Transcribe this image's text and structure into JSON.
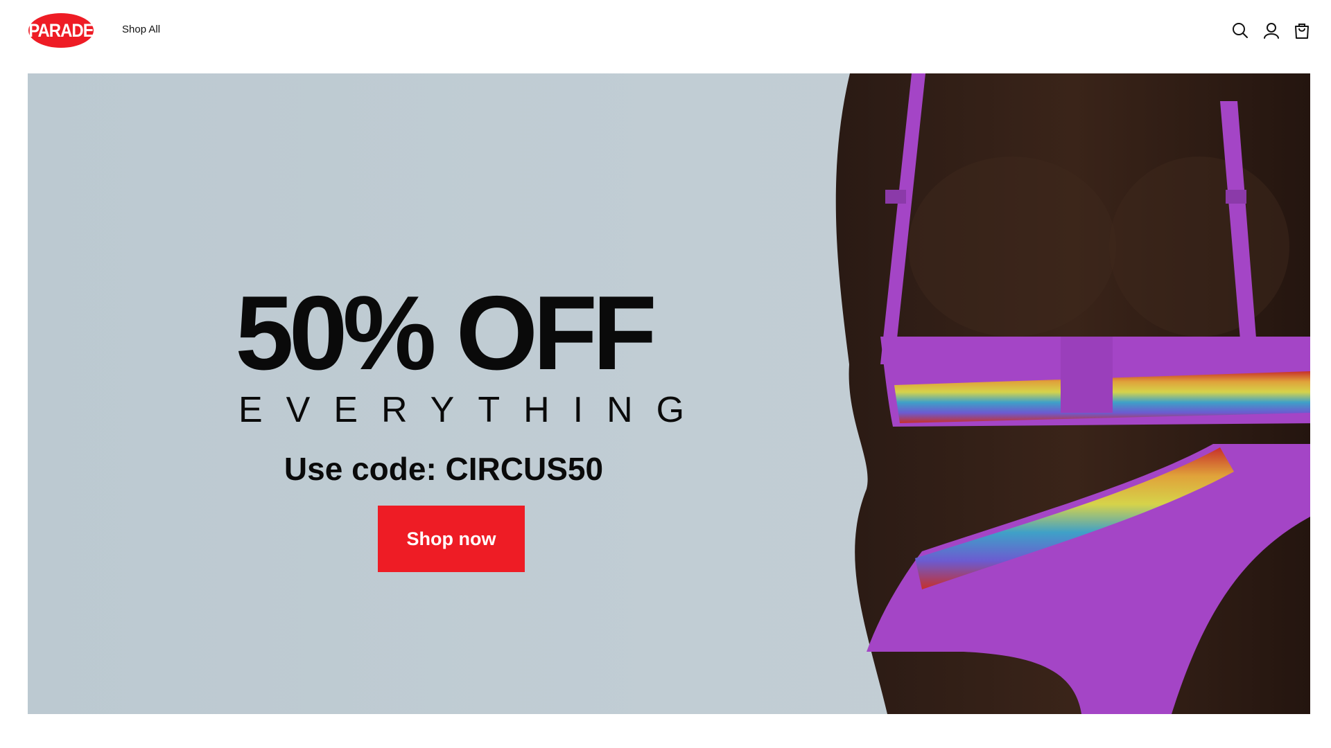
{
  "header": {
    "logo_text": "PARADE",
    "nav": [
      {
        "label": "Shop All"
      }
    ],
    "icons": [
      "search-icon",
      "account-icon",
      "cart-icon"
    ]
  },
  "hero": {
    "headline": "50% OFF",
    "subhead": "EVERYTHING",
    "code_line": "Use code: CIRCUS50",
    "cta_label": "Shop now"
  },
  "colors": {
    "brand_red": "#ee1c25",
    "hero_bg": "#bfccd3",
    "text": "#0a0a0a",
    "garment_purple": "#a445c6"
  }
}
